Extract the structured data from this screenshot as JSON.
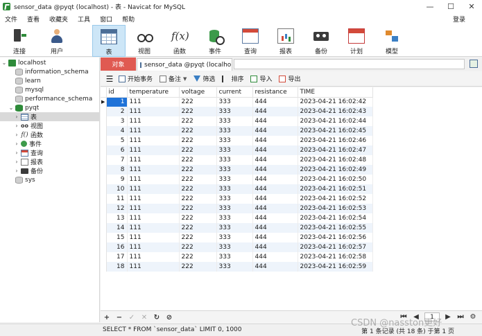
{
  "window": {
    "title": "sensor_data @pyqt (localhost) - 表 - Navicat for MySQL",
    "minimize": "—",
    "maximize": "☐",
    "close": "✕"
  },
  "menu": {
    "items": [
      "文件",
      "查看",
      "收藏夹",
      "工具",
      "窗口",
      "帮助"
    ],
    "login": "登录"
  },
  "toolbar": {
    "items": [
      {
        "label": "连接",
        "icon": "plug-connection-icon"
      },
      {
        "label": "用户",
        "icon": "user-icon"
      },
      {
        "label": "表",
        "icon": "table-icon"
      },
      {
        "label": "视图",
        "icon": "view-glasses-icon"
      },
      {
        "label": "函数",
        "icon": "function-icon"
      },
      {
        "label": "事件",
        "icon": "event-icon"
      },
      {
        "label": "查询",
        "icon": "query-icon"
      },
      {
        "label": "报表",
        "icon": "report-icon"
      },
      {
        "label": "备份",
        "icon": "backup-icon"
      },
      {
        "label": "计划",
        "icon": "schedule-icon"
      },
      {
        "label": "模型",
        "icon": "model-icon"
      }
    ],
    "active": "表",
    "func_glyph": "f(x)"
  },
  "sidebar": {
    "connection": "localhost",
    "databases": [
      "information_schema",
      "learn",
      "mysql",
      "performance_schema"
    ],
    "open_db": "pyqt",
    "open_db_children": [
      "表",
      "视图",
      "函数",
      "事件",
      "查询",
      "报表",
      "备份"
    ],
    "selected": "表",
    "other_db": "sys",
    "expand_glyph": "›",
    "expanded_glyph": "⌄"
  },
  "tabs": {
    "objects": "对象",
    "current": "sensor_data @pyqt (localho..."
  },
  "actions": {
    "menu_glyph": "☰",
    "begin_transaction": "开始事务",
    "note": "备注",
    "filter": "筛选",
    "sort": "排序",
    "import": "导入",
    "export": "导出"
  },
  "grid": {
    "columns": [
      "id",
      "temperature",
      "voltage",
      "current",
      "resistance",
      "TIME"
    ],
    "current_row_marker": "▶",
    "rows": [
      [
        "1",
        "111",
        "222",
        "333",
        "444",
        "2023-04-21 16:02:42"
      ],
      [
        "2",
        "111",
        "222",
        "333",
        "444",
        "2023-04-21 16:02:43"
      ],
      [
        "3",
        "111",
        "222",
        "333",
        "444",
        "2023-04-21 16:02:44"
      ],
      [
        "4",
        "111",
        "222",
        "333",
        "444",
        "2023-04-21 16:02:45"
      ],
      [
        "5",
        "111",
        "222",
        "333",
        "444",
        "2023-04-21 16:02:46"
      ],
      [
        "6",
        "111",
        "222",
        "333",
        "444",
        "2023-04-21 16:02:47"
      ],
      [
        "7",
        "111",
        "222",
        "333",
        "444",
        "2023-04-21 16:02:48"
      ],
      [
        "8",
        "111",
        "222",
        "333",
        "444",
        "2023-04-21 16:02:49"
      ],
      [
        "9",
        "111",
        "222",
        "333",
        "444",
        "2023-04-21 16:02:50"
      ],
      [
        "10",
        "111",
        "222",
        "333",
        "444",
        "2023-04-21 16:02:51"
      ],
      [
        "11",
        "111",
        "222",
        "333",
        "444",
        "2023-04-21 16:02:52"
      ],
      [
        "12",
        "111",
        "222",
        "333",
        "444",
        "2023-04-21 16:02:53"
      ],
      [
        "13",
        "111",
        "222",
        "333",
        "444",
        "2023-04-21 16:02:54"
      ],
      [
        "14",
        "111",
        "222",
        "333",
        "444",
        "2023-04-21 16:02:55"
      ],
      [
        "15",
        "111",
        "222",
        "333",
        "444",
        "2023-04-21 16:02:56"
      ],
      [
        "16",
        "111",
        "222",
        "333",
        "444",
        "2023-04-21 16:02:57"
      ],
      [
        "17",
        "111",
        "222",
        "333",
        "444",
        "2023-04-21 16:02:58"
      ],
      [
        "18",
        "111",
        "222",
        "333",
        "444",
        "2023-04-21 16:02:59"
      ]
    ]
  },
  "nav": {
    "add": "+",
    "remove": "−",
    "apply": "✓",
    "discard": "✕",
    "refresh": "↻",
    "stop": "⊘",
    "first": "⏮",
    "prev": "◀",
    "page": "1",
    "next": "▶",
    "last": "⏭",
    "settings": "⚙"
  },
  "status": {
    "sql": "SELECT * FROM `sensor_data` LIMIT 0, 1000",
    "record_info": "第 1 条记录 (共 18 条) 于第 1 页",
    "watermark": "CSDN @nasston更好"
  }
}
